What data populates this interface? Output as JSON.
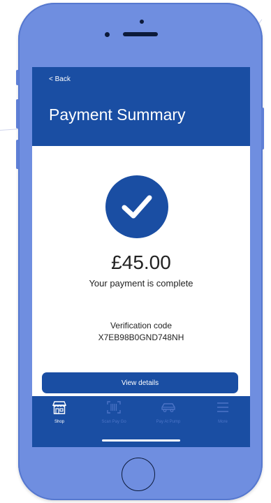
{
  "header": {
    "back_label": "< Back",
    "title": "Payment Summary"
  },
  "payment": {
    "amount": "£45.00",
    "status_message": "Your payment is complete",
    "verification_label": "Verification code",
    "verification_code": "X7EB98B0GND748NH",
    "view_details_label": "View details"
  },
  "tabbar": {
    "items": [
      {
        "label": "Shop",
        "icon": "shop-icon",
        "active": true
      },
      {
        "label": "Scan Pay Go",
        "icon": "barcode-icon",
        "active": false
      },
      {
        "label": "Pay At Pump",
        "icon": "car-icon",
        "active": false
      },
      {
        "label": "More",
        "icon": "menu-icon",
        "active": false
      }
    ]
  },
  "colors": {
    "brand": "#1a4ea3",
    "phone_body": "#6f8ee0",
    "inactive_tab": "#4c74c7"
  }
}
